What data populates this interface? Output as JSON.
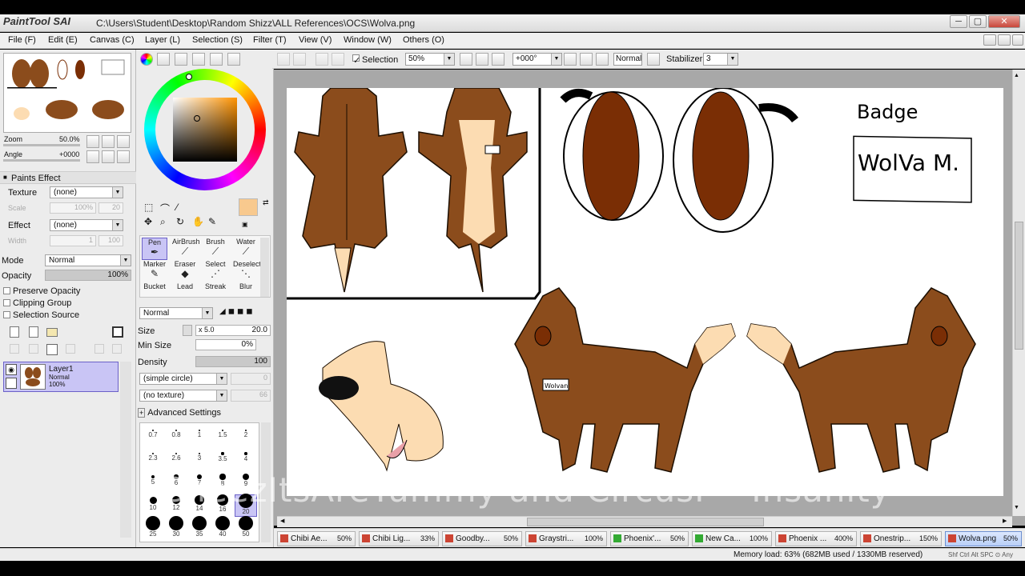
{
  "window": {
    "app_logo": "PaintTool SAI",
    "title": "C:\\Users\\Student\\Desktop\\Random Shizz\\ALL References\\OCS\\Wolva.png",
    "min_label": "─",
    "max_label": "▢",
    "close_label": "✕"
  },
  "menu": [
    "File (F)",
    "Edit (E)",
    "Canvas (C)",
    "Layer (L)",
    "Selection (S)",
    "Filter (T)",
    "View (V)",
    "Window (W)",
    "Others (O)"
  ],
  "toolbar": {
    "selection_label": "Selection",
    "zoom": "50%",
    "angle": "+000°",
    "blend": "Normal",
    "stabilizer_label": "Stabilizer",
    "stabilizer_value": "3"
  },
  "navigator": {
    "zoom_label": "Zoom",
    "zoom_value": "50.0%",
    "angle_label": "Angle",
    "angle_value": "+0000"
  },
  "paints_effect": {
    "header": "Paints Effect",
    "texture_label": "Texture",
    "texture_value": "(none)",
    "scale_label": "Scale",
    "scale_value": "100%",
    "scale_num": "20",
    "effect_label": "Effect",
    "effect_value": "(none)",
    "width_label": "Width",
    "width_value": "1",
    "width_num": "100"
  },
  "layer_props": {
    "mode_label": "Mode",
    "mode_value": "Normal",
    "opacity_label": "Opacity",
    "opacity_value": "100%",
    "opacity_fraction": 1.0,
    "preserve_opacity": "Preserve Opacity",
    "clipping_group": "Clipping Group",
    "selection_source": "Selection Source"
  },
  "layers": [
    {
      "name": "Layer1",
      "mode": "Normal",
      "opacity": "100%"
    }
  ],
  "tools": {
    "row1": [
      "Pen",
      "AirBrush",
      "Brush",
      "Water"
    ],
    "row2": [
      "Marker",
      "Eraser",
      "Select",
      "Deselect"
    ],
    "row3": [
      "Bucket",
      "Lead",
      "Streak",
      "Blur"
    ]
  },
  "brush": {
    "mode": "Normal",
    "size_label": "Size",
    "size_mult": "x 5.0",
    "size_value": "20.0",
    "min_size_label": "Min Size",
    "min_size_value": "0%",
    "density_label": "Density",
    "density_value": "100",
    "shape": "(simple circle)",
    "shape_num": "0",
    "texture": "(no texture)",
    "texture_num": "66",
    "advanced": "Advanced Settings",
    "sizes": [
      "0.7",
      "0.8",
      "1",
      "1.5",
      "2",
      "2.3",
      "2.6",
      "3",
      "3.5",
      "4",
      "5",
      "6",
      "7",
      "8",
      "9",
      "10",
      "12",
      "14",
      "16",
      "20",
      "25",
      "30",
      "35",
      "40",
      "50"
    ]
  },
  "canvas_text": {
    "badge_title": "Badge",
    "badge_name": "WolVa M.",
    "collar_tag": "Wolvan"
  },
  "doc_tabs": [
    {
      "name": "Chibi Ae...",
      "zoom": "50%"
    },
    {
      "name": "Chibi Lig...",
      "zoom": "33%"
    },
    {
      "name": "Goodby...",
      "zoom": "50%"
    },
    {
      "name": "Graystri...",
      "zoom": "100%"
    },
    {
      "name": "Phoenix'...",
      "zoom": "50%"
    },
    {
      "name": "New Ca...",
      "zoom": "100%"
    },
    {
      "name": "Phoenix ...",
      "zoom": "400%"
    },
    {
      "name": "Onestrip...",
      "zoom": "150%"
    },
    {
      "name": "Wolva.png",
      "zoom": "50%"
    }
  ],
  "status": {
    "memory": "Memory load: 63% (682MB used / 1330MB reserved)",
    "keys": "Shf Ctrl Alt SPC ⊙ Any"
  },
  "overlay": {
    "watermark": "CheezItsAreYummy and CircusP - Insanity"
  },
  "colors": {
    "fur_dark": "#6b3a12",
    "fur_mid": "#8b4c1c",
    "fur_light": "#fcdcb2",
    "eye": "#7a2e05",
    "accent_primary": "#f8c98e"
  }
}
